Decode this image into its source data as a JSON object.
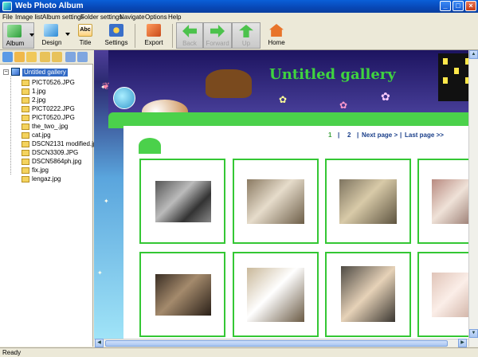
{
  "window": {
    "title": "Web Photo Album",
    "controls": {
      "minimize": "_",
      "maximize": "□",
      "close": "×"
    }
  },
  "menu": [
    "File",
    "Image list",
    "Album settings",
    "Folder settings",
    "Navigate",
    "Options",
    "Help"
  ],
  "toolbar": {
    "album": "Album",
    "design": "Design",
    "title": "Title",
    "settings": "Settings",
    "export": "Export",
    "back": "Back",
    "forward": "Forward",
    "up": "Up",
    "home": "Home"
  },
  "tree": {
    "root": "Untitled gallery",
    "items": [
      "PICT0526.JPG",
      "1.jpg",
      "2.jpg",
      "PICT0222.JPG",
      "PICT0520.JPG",
      "the_two_.jpg",
      "cat.jpg",
      "DSCN2131 modified.jpg",
      "DSCN3309.JPG",
      "DSCN5864ph.jpg",
      "fix.jpg",
      "lengaz.jpg"
    ]
  },
  "gallery": {
    "title": "Untitled gallery",
    "pager": {
      "page1": "1",
      "sep1": "|",
      "page2": "2",
      "sep2": "|",
      "next": "Next page >",
      "sep3": "|",
      "last": "Last page >>"
    }
  },
  "status": "Ready",
  "colors": {
    "accent_green": "#34c734",
    "title_green": "#3fd33f",
    "selection": "#316ac5",
    "titlebar": "#0a5fd8"
  }
}
